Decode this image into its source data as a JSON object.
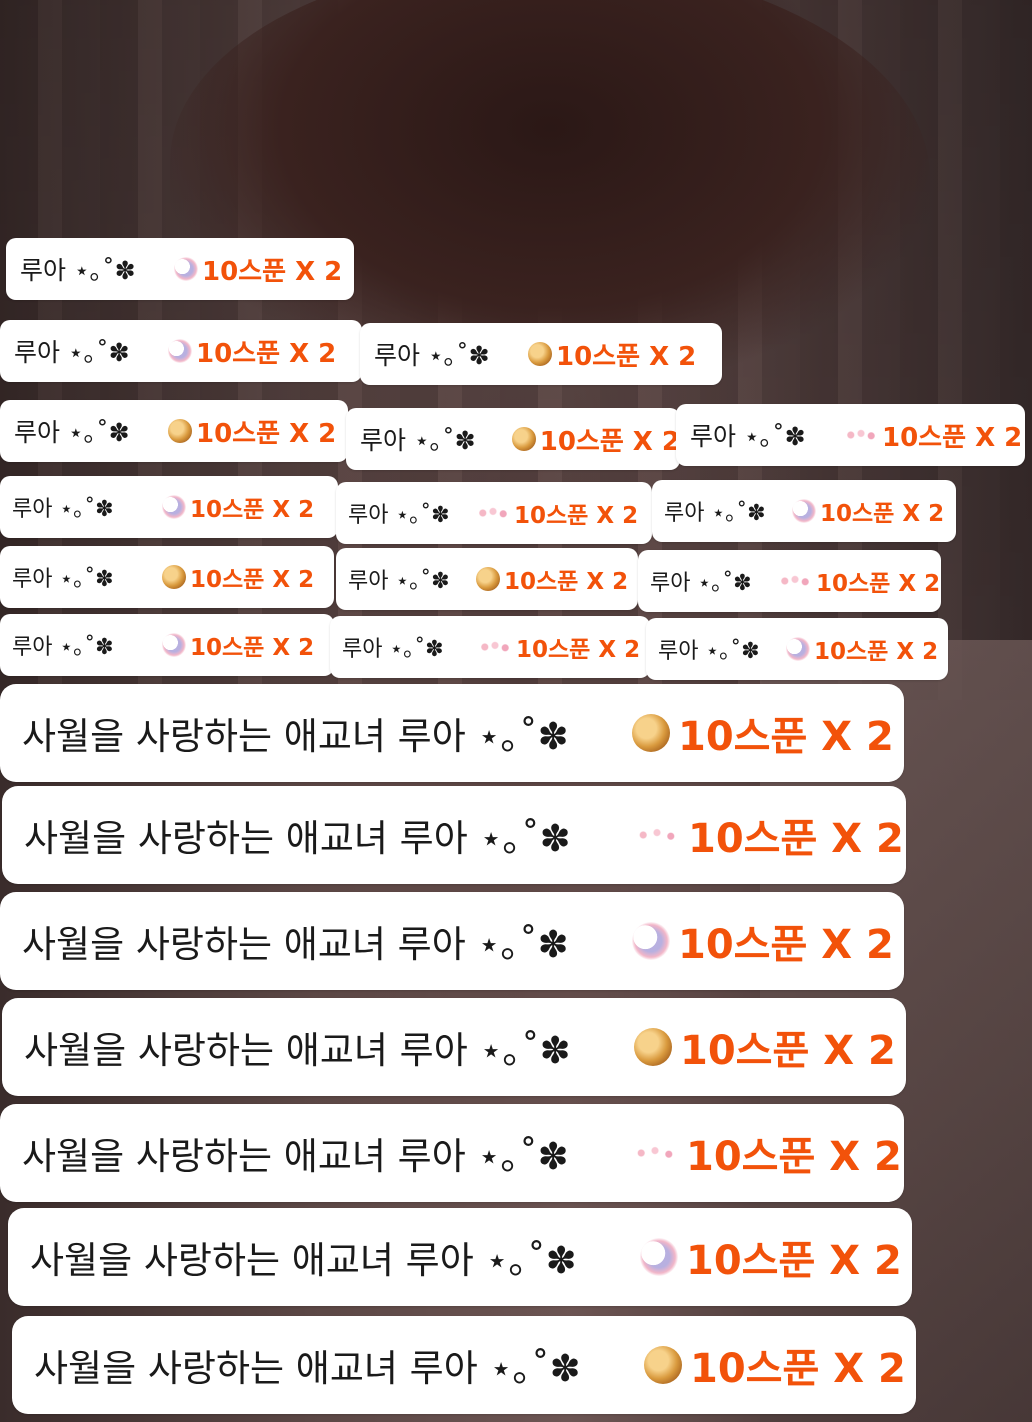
{
  "messages": [
    {
      "name": "루아 ⋆｡˚✽",
      "icon": "moon-icon",
      "amount": "10스푼 X 2"
    },
    {
      "name": "루아 ⋆｡˚✽",
      "icon": "moon-icon",
      "amount": "10스푼 X 2"
    },
    {
      "name": "루아 ⋆｡˚✽",
      "icon": "cookie-icon",
      "amount": "10스푼 X 2"
    },
    {
      "name": "루아 ⋆｡˚✽",
      "icon": "cookie-icon",
      "amount": "10스푼 X 2"
    },
    {
      "name": "루아 ⋆｡˚✽",
      "icon": "cookie-icon",
      "amount": "10스푼 X 2"
    },
    {
      "name": "루아 ⋆｡˚✽",
      "icon": "flower-icon",
      "amount": "10스푼 X 2"
    },
    {
      "name": "루아 ⋆｡˚✽",
      "icon": "moon-icon",
      "amount": "10스푼 X 2"
    },
    {
      "name": "루아 ⋆｡˚✽",
      "icon": "flower-icon",
      "amount": "10스푼 X 2"
    },
    {
      "name": "루아 ⋆｡˚✽",
      "icon": "moon-icon",
      "amount": "10스푼 X 2"
    },
    {
      "name": "루아 ⋆｡˚✽",
      "icon": "cookie-icon",
      "amount": "10스푼 X 2"
    },
    {
      "name": "루아 ⋆｡˚✽",
      "icon": "cookie-icon",
      "amount": "10스푼 X 2"
    },
    {
      "name": "루아 ⋆｡˚✽",
      "icon": "flower-icon",
      "amount": "10스푼 X 2"
    },
    {
      "name": "루아 ⋆｡˚✽",
      "icon": "moon-icon",
      "amount": "10스푼 X 2"
    },
    {
      "name": "루아 ⋆｡˚✽",
      "icon": "flower-icon",
      "amount": "10스푼 X 2"
    },
    {
      "name": "루아 ⋆｡˚✽",
      "icon": "moon-icon",
      "amount": "10스푼 X 2"
    },
    {
      "name": "사월을 사랑하는 애교녀 루아 ⋆｡˚✽",
      "icon": "cookie-icon",
      "amount": "10스푼 X 2"
    },
    {
      "name": "사월을 사랑하는 애교녀 루아 ⋆｡˚✽",
      "icon": "flower-icon",
      "amount": "10스푼 X 2"
    },
    {
      "name": "사월을 사랑하는 애교녀 루아 ⋆｡˚✽",
      "icon": "moon-icon",
      "amount": "10스푼 X 2"
    },
    {
      "name": "사월을 사랑하는 애교녀 루아 ⋆｡˚✽",
      "icon": "cookie-icon",
      "amount": "10스푼 X 2"
    },
    {
      "name": "사월을 사랑하는 애교녀 루아 ⋆｡˚✽",
      "icon": "flower-icon",
      "amount": "10스푼 X 2"
    },
    {
      "name": "사월을 사랑하는 애교녀 루아 ⋆｡˚✽",
      "icon": "moon-icon",
      "amount": "10스푼 X 2"
    },
    {
      "name": "사월을 사랑하는 애교녀 루아 ⋆｡˚✽",
      "icon": "cookie-icon",
      "amount": "10스푼 X 2"
    }
  ],
  "colors": {
    "amount": "#f2520a",
    "chip_background": "#ffffff",
    "name_text": "#1a1a1a"
  }
}
